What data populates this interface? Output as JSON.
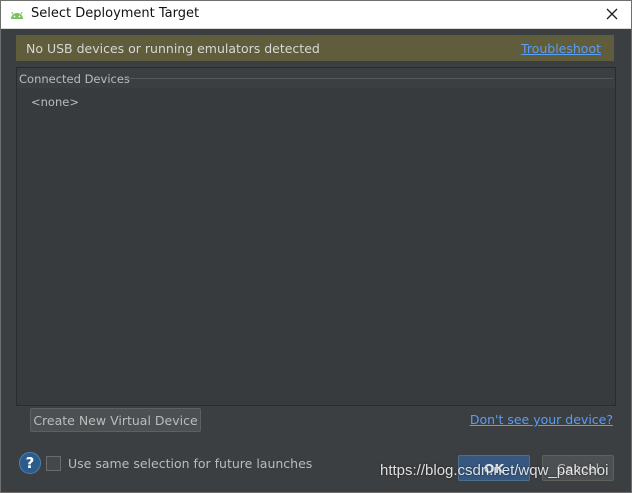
{
  "window": {
    "title": "Select Deployment Target",
    "app_icon": "android-icon",
    "close_icon": "close-icon"
  },
  "banner": {
    "message": "No USB devices or running emulators detected",
    "link": "Troubleshoot",
    "background": "#5f5d3b"
  },
  "devices": {
    "section_label": "Connected Devices",
    "empty_text": "<none>"
  },
  "actions": {
    "create_button": "Create New Virtual Device",
    "dont_see_link": "Don't see your device?"
  },
  "footer": {
    "help_icon": "help-icon",
    "help_symbol": "?",
    "checkbox_label": "Use same selection for future launches",
    "checkbox_checked": false,
    "ok_button": "OK",
    "cancel_button": "Cancel"
  },
  "watermark": "https://blog.csdn.net/wqw_pakchoi",
  "colors": {
    "accent": "#589df6",
    "primary_button": "#365880",
    "panel": "#3c3f41"
  }
}
